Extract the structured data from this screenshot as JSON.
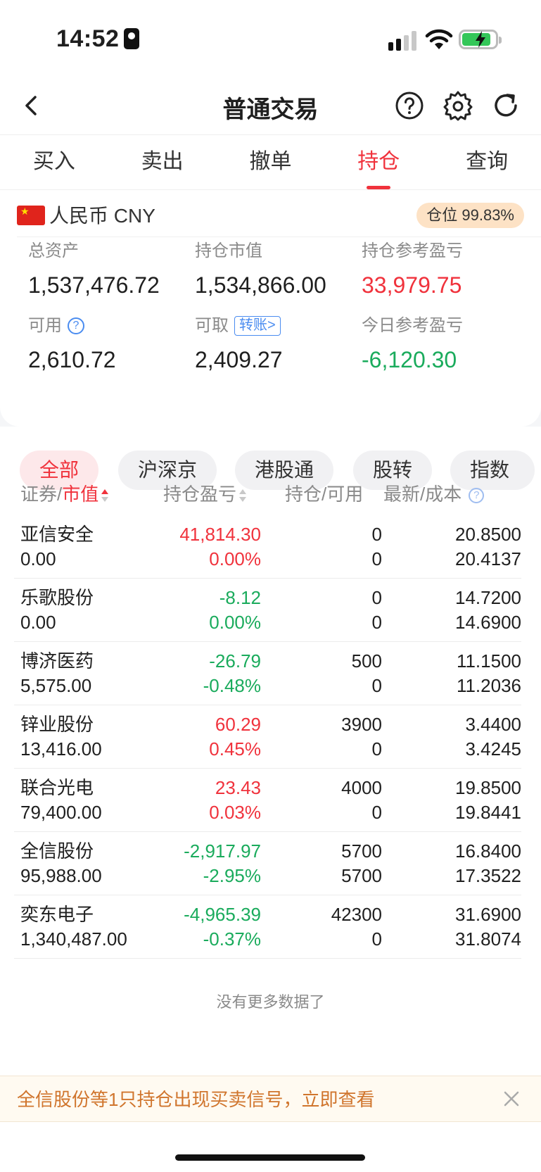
{
  "status_bar": {
    "time": "14:52"
  },
  "nav": {
    "title": "普通交易"
  },
  "tabs": [
    {
      "label": "买入",
      "active": false
    },
    {
      "label": "卖出",
      "active": false
    },
    {
      "label": "撤单",
      "active": false
    },
    {
      "label": "持仓",
      "active": true
    },
    {
      "label": "查询",
      "active": false
    }
  ],
  "account": {
    "currency": "人民币 CNY",
    "position_ratio": "仓位 99.83%",
    "total_assets_label": "总资产",
    "total_assets": "1,537,476.72",
    "market_value_label": "持仓市值",
    "market_value": "1,534,866.00",
    "holding_pl_label": "持仓参考盈亏",
    "holding_pl": "33,979.75",
    "available_label": "可用",
    "available": "2,610.72",
    "withdrawable_label": "可取",
    "transfer_label": "转账>",
    "withdrawable": "2,409.27",
    "today_pl_label": "今日参考盈亏",
    "today_pl": "-6,120.30"
  },
  "filters": [
    "全部",
    "沪深京",
    "港股通",
    "股转",
    "指数"
  ],
  "table": {
    "col1_a": "证券",
    "col1_sep": "/",
    "col1_b": "市值",
    "col2": "持仓盈亏",
    "col3": "持仓/可用",
    "col4": "最新/成本",
    "rows": [
      {
        "name": "亚信安全",
        "market_value": "0.00",
        "pl": "41,814.30",
        "pl_pct": "0.00%",
        "pl_color": "red",
        "pct_color": "red",
        "holding": "0",
        "available": "0",
        "latest": "20.8500",
        "cost": "20.4137"
      },
      {
        "name": "乐歌股份",
        "market_value": "0.00",
        "pl": "-8.12",
        "pl_pct": "0.00%",
        "pl_color": "green",
        "pct_color": "green",
        "holding": "0",
        "available": "0",
        "latest": "14.7200",
        "cost": "14.6900"
      },
      {
        "name": "博济医药",
        "market_value": "5,575.00",
        "pl": "-26.79",
        "pl_pct": "-0.48%",
        "pl_color": "green",
        "pct_color": "green",
        "holding": "500",
        "available": "0",
        "latest": "11.1500",
        "cost": "11.2036"
      },
      {
        "name": "锌业股份",
        "market_value": "13,416.00",
        "pl": "60.29",
        "pl_pct": "0.45%",
        "pl_color": "red",
        "pct_color": "red",
        "holding": "3900",
        "available": "0",
        "latest": "3.4400",
        "cost": "3.4245"
      },
      {
        "name": "联合光电",
        "market_value": "79,400.00",
        "pl": "23.43",
        "pl_pct": "0.03%",
        "pl_color": "red",
        "pct_color": "red",
        "holding": "4000",
        "available": "0",
        "latest": "19.8500",
        "cost": "19.8441"
      },
      {
        "name": "全信股份",
        "market_value": "95,988.00",
        "pl": "-2,917.97",
        "pl_pct": "-2.95%",
        "pl_color": "green",
        "pct_color": "green",
        "holding": "5700",
        "available": "5700",
        "latest": "16.8400",
        "cost": "17.3522"
      },
      {
        "name": "奕东电子",
        "market_value": "1,340,487.00",
        "pl": "-4,965.39",
        "pl_pct": "-0.37%",
        "pl_color": "green",
        "pct_color": "green",
        "holding": "42300",
        "available": "0",
        "latest": "31.6900",
        "cost": "31.8074"
      }
    ],
    "no_more": "没有更多数据了"
  },
  "banner": {
    "text": "全信股份等1只持仓出现买卖信号，立即查看"
  },
  "colors": {
    "up_red": "#f0323c",
    "down_green": "#1aab5c",
    "link_blue": "#4a8cf0",
    "banner_orange": "#d0752d"
  },
  "icons": [
    "back-icon",
    "help-icon",
    "settings-icon",
    "refresh-icon",
    "close-icon"
  ]
}
